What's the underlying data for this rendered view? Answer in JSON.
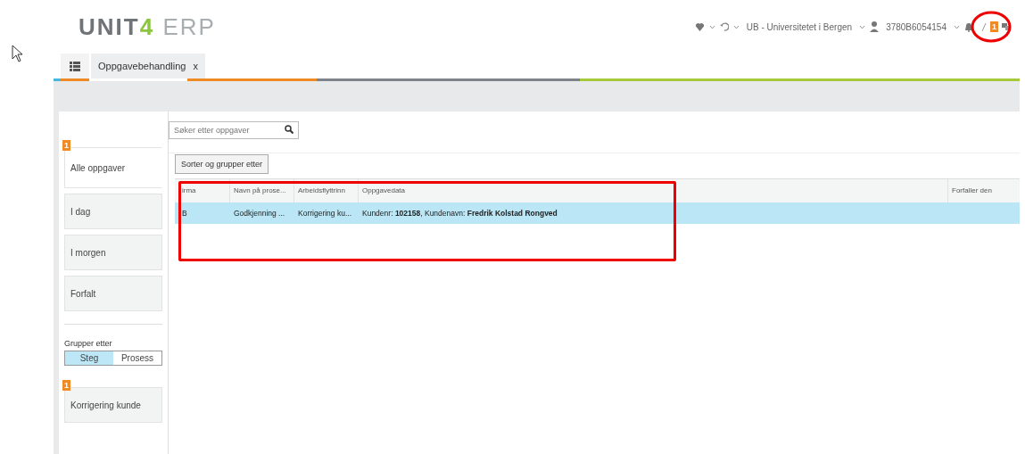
{
  "header": {
    "logo_main": "UNIT",
    "logo_digit": "4",
    "logo_suffix": "ERP",
    "company": "UB - Universitetet i Bergen",
    "user": "3780B6054154",
    "notification_badge": "1"
  },
  "tabs": [
    {
      "label": "Oppgavebehandling",
      "close": "x",
      "selected": true
    }
  ],
  "search": {
    "placeholder": "Søker etter oppgaver"
  },
  "sidebar": {
    "items": [
      {
        "label": "Alle oppgaver",
        "badge": "1",
        "selected": true
      },
      {
        "label": "I dag",
        "selected": false
      },
      {
        "label": "I morgen",
        "selected": false
      },
      {
        "label": "Forfalt",
        "selected": false
      }
    ],
    "group_label": "Grupper etter",
    "group_options": [
      {
        "label": "Steg",
        "selected": true
      },
      {
        "label": "Prosess",
        "selected": false
      }
    ],
    "groups": [
      {
        "label": "Korrigering kunde",
        "badge": "1"
      }
    ]
  },
  "sort_button": "Sorter og grupper etter",
  "table": {
    "columns": [
      "irma",
      "Navn på prose...",
      "Arbeidsflyttrinn",
      "Oppgavedata",
      "Forfaller den"
    ],
    "rows": [
      {
        "cells": [
          "B",
          "Godkjenning ...",
          "Korrigering ku...",
          "Kundenr: **102158**, Kundenavn: **Fredrik Kolstad Rongved**",
          ""
        ],
        "selected": true
      }
    ]
  }
}
